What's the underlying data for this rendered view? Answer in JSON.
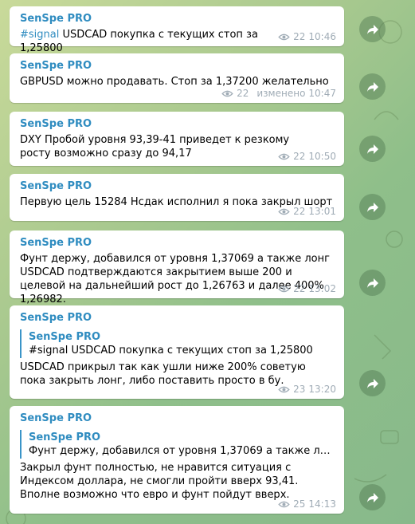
{
  "messages": [
    {
      "sender": "SenSpe PRO",
      "hashtag": "#signal",
      "text": " USDCAD покупка с текущих стоп за 1,25800",
      "views": "22",
      "edited": "",
      "time": "10:46"
    },
    {
      "sender": "SenSpe PRO",
      "text": "GBPUSD можно продавать. Стоп за 1,37200 желательно",
      "views": "22",
      "edited": "изменено",
      "time": "10:47"
    },
    {
      "sender": "SenSpe PRO",
      "text": "DXY Пробой уровня 93,39-41 приведет к резкому росту возможно сразу до 94,17",
      "views": "22",
      "time": "10:50"
    },
    {
      "sender": "SenSpe PRO",
      "text": "Первую цель 15284 Нсдак исполнил я пока закрыл шорт",
      "views": "22",
      "time": "13:01"
    },
    {
      "sender": "SenSpe PRO",
      "text": "Фунт держу, добавился от уровня 1,37069  а также лонг USDCAD подтверждаются закрытием выше 200 и целевой на дальнейший рост до 1,26763 и далее 400% 1,26982.",
      "views": "22",
      "time": "13:02"
    },
    {
      "sender": "SenSpe PRO",
      "reply": {
        "name": "SenSpe PRO",
        "text": "#signal USDCAD покупка с текущих стоп за 1,25800"
      },
      "text": "USDCAD прикрыл так как ушли ниже 200% советую пока закрыть лонг, либо поставить просто в бу.",
      "views": "23",
      "time": "13:20"
    },
    {
      "sender": "SenSpe PRO",
      "reply": {
        "name": "SenSpe PRO",
        "text": "Фунт держу, добавился от уровня 1,37069  а также лонг USDC..."
      },
      "text": "Закрыл фунт полностью, не нравится ситуация с Индексом доллара, не смогли пройти вверх 93,41. Вполне возможно что евро и фунт пойдут вверх.",
      "views": "25",
      "time": "14:13"
    }
  ]
}
